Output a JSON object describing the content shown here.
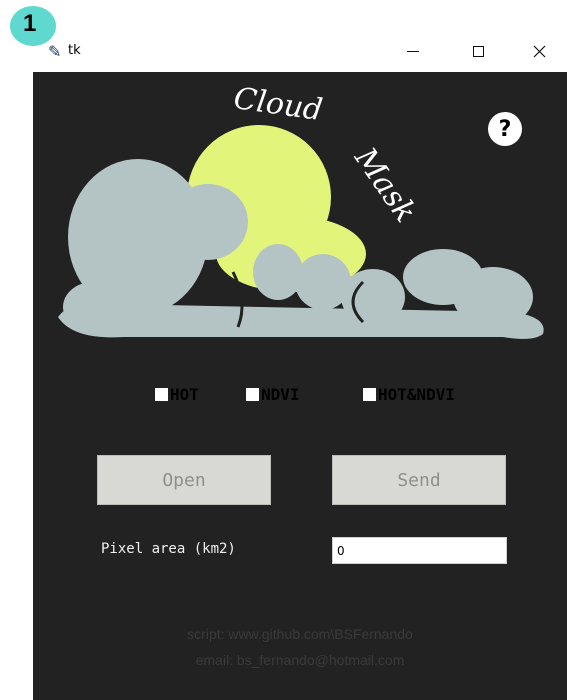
{
  "badge": {
    "number": "1"
  },
  "window": {
    "title": "tk",
    "icon": "feather-icon",
    "controls": {
      "minimize": "minimize-icon",
      "maximize": "maximize-icon",
      "close": "close-icon"
    }
  },
  "logo": {
    "text": "Cloud Mask"
  },
  "help": {
    "label": "?"
  },
  "options": [
    {
      "label": "HOT",
      "checked": false
    },
    {
      "label": "NDVI",
      "checked": false
    },
    {
      "label": "HOT&NDVI",
      "checked": false
    }
  ],
  "buttons": {
    "open": "Open",
    "send": "Send"
  },
  "pixel_area": {
    "label": "Pixel area (km2)",
    "value": "0"
  },
  "footer": {
    "script": "script: www.github.com\\BSFernando",
    "email": "email: bs_fernando@hotmail.com"
  },
  "colors": {
    "background": "#222222",
    "sun": "#e2f57a",
    "cloud": "#b4c4c4"
  }
}
